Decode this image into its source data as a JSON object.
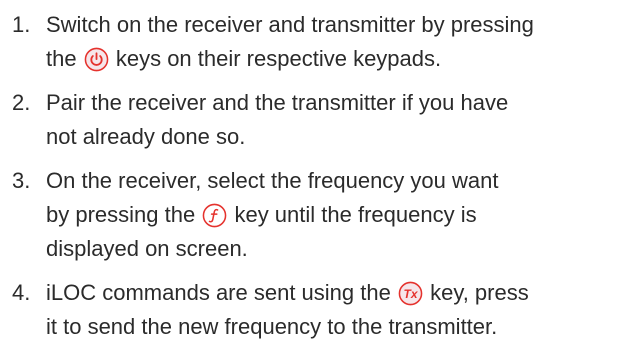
{
  "steps": [
    {
      "number": "1.",
      "line1_pre": "Switch on the receiver and transmitter by pressing",
      "line2_pre": "the",
      "line2_post": "keys on their respective keypads.",
      "icon": "power-key-icon"
    },
    {
      "number": "2.",
      "line1": "Pair the receiver and the transmitter if you have",
      "line2": "not already done so."
    },
    {
      "number": "3.",
      "line1": "On the receiver, select the frequency you want",
      "line2_pre": "by pressing the",
      "line2_post": "key until the frequency is",
      "line3": "displayed on screen.",
      "icon": "frequency-key-icon"
    },
    {
      "number": "4.",
      "line1_pre": "iLOC commands are sent using the",
      "line1_post": "key, press",
      "line2": "it to send the new frequency to the transmitter.",
      "icon": "tx-key-icon",
      "icon_label": "Tx"
    }
  ],
  "colors": {
    "text": "#2b2b2b",
    "key_accent": "#e5322d",
    "key_fill": "#f6e6ea",
    "freq_fill": "#ffffff"
  }
}
